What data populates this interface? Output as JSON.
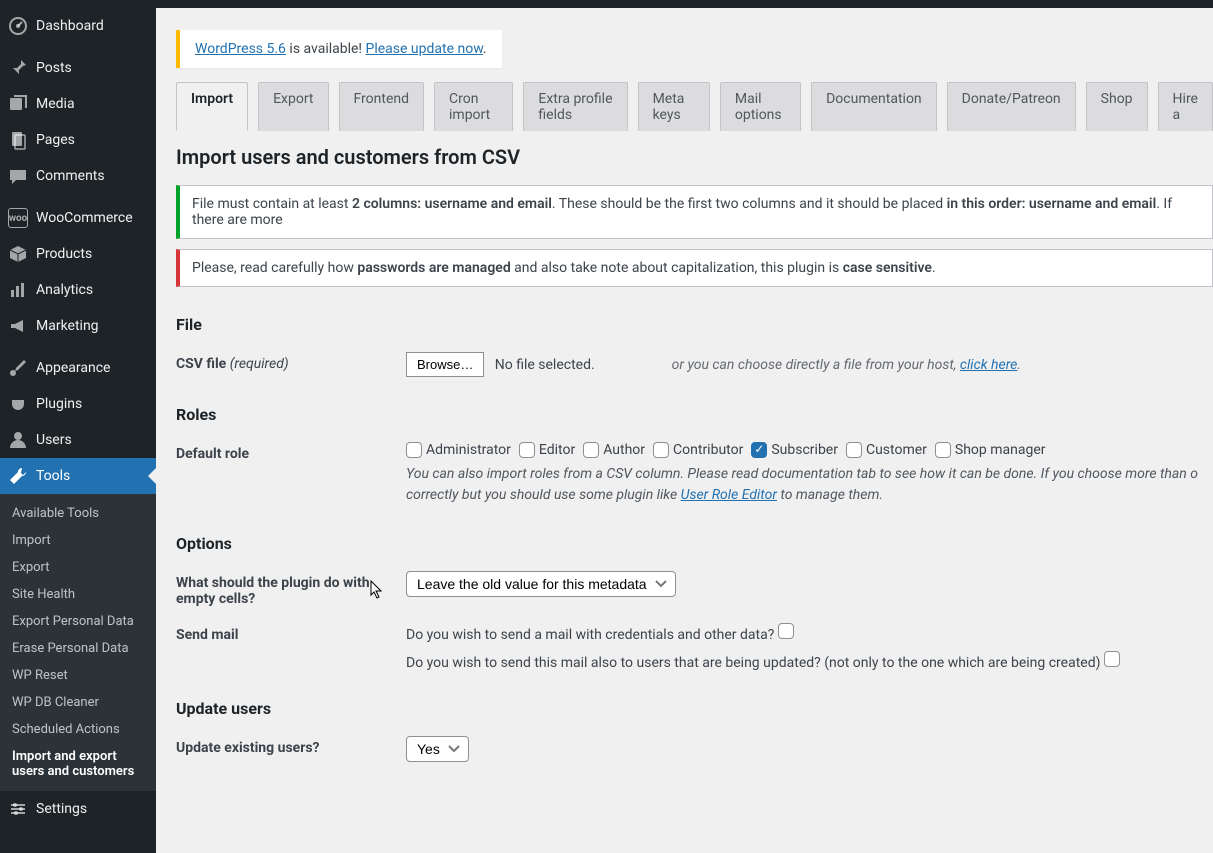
{
  "sidebar": {
    "items": [
      {
        "label": "Dashboard",
        "icon": "gauge"
      },
      {
        "label": "Posts",
        "icon": "pin"
      },
      {
        "label": "Media",
        "icon": "media"
      },
      {
        "label": "Pages",
        "icon": "pages"
      },
      {
        "label": "Comments",
        "icon": "comment"
      },
      {
        "label": "WooCommerce",
        "icon": "woo"
      },
      {
        "label": "Products",
        "icon": "box"
      },
      {
        "label": "Analytics",
        "icon": "chart"
      },
      {
        "label": "Marketing",
        "icon": "megaphone"
      },
      {
        "label": "Appearance",
        "icon": "brush"
      },
      {
        "label": "Plugins",
        "icon": "plug"
      },
      {
        "label": "Users",
        "icon": "user"
      },
      {
        "label": "Tools",
        "icon": "wrench",
        "active": true
      },
      {
        "label": "Settings",
        "icon": "gear"
      }
    ],
    "subitems": [
      "Available Tools",
      "Import",
      "Export",
      "Site Health",
      "Export Personal Data",
      "Erase Personal Data",
      "WP Reset",
      "WP DB Cleaner",
      "Scheduled Actions",
      "Import and export users and customers"
    ]
  },
  "nag": {
    "link1": "WordPress 5.6",
    "mid": " is available! ",
    "link2": "Please update now"
  },
  "tabs": [
    "Import",
    "Export",
    "Frontend",
    "Cron import",
    "Extra profile fields",
    "Meta keys",
    "Mail options",
    "Documentation",
    "Donate/Patreon",
    "Shop",
    "Hire a"
  ],
  "page_title": "Import users and customers from CSV",
  "notice1": {
    "pre": "File must contain at least ",
    "b1": "2 columns: username and email",
    "mid": ". These should be the first two columns and it should be placed ",
    "b2": "in this order: username and email",
    "post": ". If there are more"
  },
  "notice2": {
    "pre": "Please, read carefully how ",
    "b1": "passwords are managed",
    "mid": " and also take note about capitalization, this plugin is ",
    "b2": "case sensitive",
    "post": "."
  },
  "file_section": {
    "heading": "File",
    "label": "CSV file ",
    "required": "(required)",
    "browse": "Browse…",
    "no_file": "No file selected.",
    "or_choose": "or you can choose directly a file from your host, ",
    "click_here": "click here"
  },
  "roles_section": {
    "heading": "Roles",
    "label": "Default role",
    "roles": [
      "Administrator",
      "Editor",
      "Author",
      "Contributor",
      "Subscriber",
      "Customer",
      "Shop manager"
    ],
    "checked": "Subscriber",
    "help_pre": "You can also import roles from a CSV column. Please read documentation tab to see how it can be done. If you choose more than o",
    "help_mid": "correctly but you should use some plugin like ",
    "help_link": "User Role Editor",
    "help_post": " to manage them."
  },
  "options_section": {
    "heading": "Options",
    "empty_cells_label": "What should the plugin do with empty cells?",
    "empty_cells_value": "Leave the old value for this metadata",
    "send_mail_label": "Send mail",
    "send_mail_q1": "Do you wish to send a mail with credentials and other data?",
    "send_mail_q2": "Do you wish to send this mail also to users that are being updated? (not only to the one which are being created)"
  },
  "update_section": {
    "heading": "Update users",
    "label": "Update existing users?",
    "value": "Yes"
  }
}
